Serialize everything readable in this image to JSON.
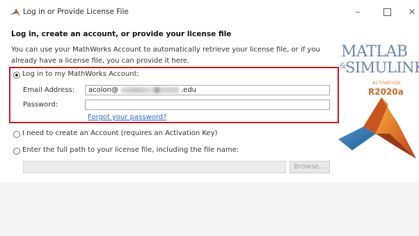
{
  "window": {
    "title": "Log in or Provide License File",
    "controls": {
      "minimize": "–",
      "close": "×"
    }
  },
  "heading": "Log in, create an account, or provide your license file",
  "description": "You can use your MathWorks Account to automatically retrieve your license file, or if you already have a license file, you can provide it here.",
  "login_option": {
    "label": "Log in to my MathWorks Account:",
    "selected": true,
    "email_label": "Email Address:",
    "email_value_visible": "acolon@",
    "email_value_domain": ".edu",
    "password_label": "Password:",
    "password_value": "",
    "forgot_link": "Forgot your password?"
  },
  "create_account_option": {
    "label": "I need to create an Account (requires an Activation Key)",
    "selected": false
  },
  "license_file_option": {
    "label": "Enter the full path to your license file, including the file name:",
    "selected": false,
    "path_value": "",
    "browse_label": "Browse..."
  },
  "branding": {
    "line1": "MATLAB",
    "line2": "SIMULINK",
    "activation": "ACTIVATION",
    "version": "R2020a"
  },
  "colors": {
    "highlight_border": "#d9141a",
    "link": "#2a6bd0",
    "brand_blue": "#6b86a8",
    "brand_orange": "#cc6a1f"
  }
}
